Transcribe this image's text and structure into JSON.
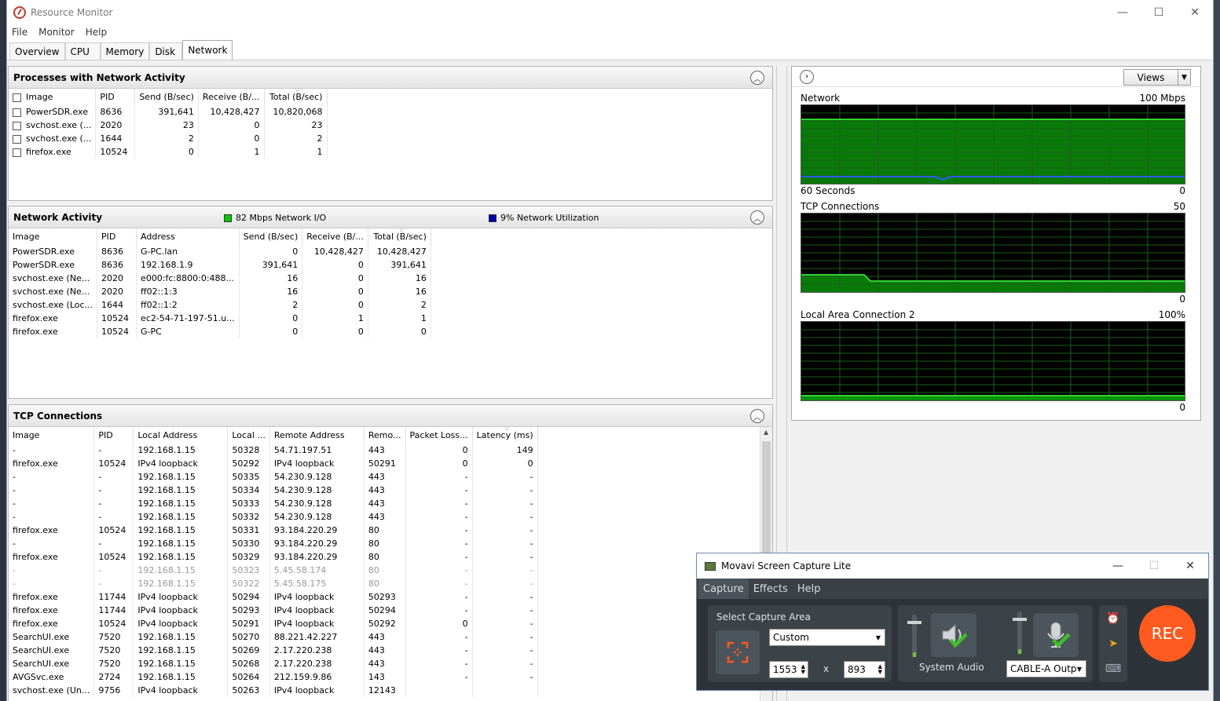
{
  "window": {
    "title": "Resource Monitor",
    "controls": {
      "minimize": "—",
      "maximize": "☐",
      "close": "✕"
    }
  },
  "menu": [
    "File",
    "Monitor",
    "Help"
  ],
  "tabs": [
    "Overview",
    "CPU",
    "Memory",
    "Disk",
    "Network"
  ],
  "active_tab": "Network",
  "processes": {
    "title": "Processes with Network Activity",
    "columns": [
      "Image",
      "PID",
      "Send (B/sec)",
      "Receive (B/...",
      "Total (B/sec)"
    ],
    "rows": [
      [
        "PowerSDR.exe",
        "8636",
        "391,641",
        "10,428,427",
        "10,820,068"
      ],
      [
        "svchost.exe (...",
        "2020",
        "23",
        "0",
        "23"
      ],
      [
        "svchost.exe (...",
        "1644",
        "2",
        "0",
        "2"
      ],
      [
        "firefox.exe",
        "10524",
        "0",
        "1",
        "1"
      ]
    ]
  },
  "network_activity": {
    "title": "Network Activity",
    "legend_io": "82 Mbps Network I/O",
    "legend_util": "9% Network Utilization",
    "legend_io_color": "#00cc00",
    "legend_util_color": "#0000aa",
    "columns": [
      "Image",
      "PID",
      "Address",
      "Send (B/sec)",
      "Receive (B/...",
      "Total (B/sec)"
    ],
    "rows": [
      [
        "PowerSDR.exe",
        "8636",
        "G-PC.lan",
        "0",
        "10,428,427",
        "10,428,427"
      ],
      [
        "PowerSDR.exe",
        "8636",
        "192.168.1.9",
        "391,641",
        "0",
        "391,641"
      ],
      [
        "svchost.exe (Ne...",
        "2020",
        "e000:fc:8800:0:488...",
        "16",
        "0",
        "16"
      ],
      [
        "svchost.exe (Ne...",
        "2020",
        "ff02::1:3",
        "16",
        "0",
        "16"
      ],
      [
        "svchost.exe (Loc...",
        "1644",
        "ff02::1:2",
        "2",
        "0",
        "2"
      ],
      [
        "firefox.exe",
        "10524",
        "ec2-54-71-197-51.u...",
        "0",
        "1",
        "1"
      ],
      [
        "firefox.exe",
        "10524",
        "G-PC",
        "0",
        "0",
        "0"
      ]
    ]
  },
  "tcp": {
    "title": "TCP Connections",
    "columns": [
      "Image",
      "PID",
      "Local Address",
      "Local ...",
      "Remote Address",
      "Remo...",
      "Packet Loss...",
      "Latency (ms)"
    ],
    "rows": [
      [
        "-",
        "-",
        "192.168.1.15",
        "50328",
        "54.71.197.51",
        "443",
        "0",
        "149"
      ],
      [
        "firefox.exe",
        "10524",
        "IPv4 loopback",
        "50292",
        "IPv4 loopback",
        "50291",
        "0",
        "0"
      ],
      [
        "-",
        "-",
        "192.168.1.15",
        "50335",
        "54.230.9.128",
        "443",
        "-",
        "-"
      ],
      [
        "-",
        "-",
        "192.168.1.15",
        "50334",
        "54.230.9.128",
        "443",
        "-",
        "-"
      ],
      [
        "-",
        "-",
        "192.168.1.15",
        "50333",
        "54.230.9.128",
        "443",
        "-",
        "-"
      ],
      [
        "-",
        "-",
        "192.168.1.15",
        "50332",
        "54.230.9.128",
        "443",
        "-",
        "-"
      ],
      [
        "firefox.exe",
        "10524",
        "192.168.1.15",
        "50331",
        "93.184.220.29",
        "80",
        "-",
        "-"
      ],
      [
        "-",
        "-",
        "192.168.1.15",
        "50330",
        "93.184.220.29",
        "80",
        "-",
        "-"
      ],
      [
        "firefox.exe",
        "10524",
        "192.168.1.15",
        "50329",
        "93.184.220.29",
        "80",
        "-",
        "-"
      ],
      [
        "-",
        "-",
        "192.168.1.15",
        "50323",
        "5.45.58.174",
        "80",
        "-",
        "-"
      ],
      [
        "-",
        "-",
        "192.168.1.15",
        "50322",
        "5.45.58.175",
        "80",
        "-",
        "-"
      ],
      [
        "firefox.exe",
        "11744",
        "IPv4 loopback",
        "50294",
        "IPv4 loopback",
        "50293",
        "-",
        "-"
      ],
      [
        "firefox.exe",
        "11744",
        "IPv4 loopback",
        "50293",
        "IPv4 loopback",
        "50294",
        "-",
        "-"
      ],
      [
        "firefox.exe",
        "10524",
        "IPv4 loopback",
        "50291",
        "IPv4 loopback",
        "50292",
        "0",
        "-"
      ],
      [
        "SearchUI.exe",
        "7520",
        "192.168.1.15",
        "50270",
        "88.221.42.227",
        "443",
        "-",
        "-"
      ],
      [
        "SearchUI.exe",
        "7520",
        "192.168.1.15",
        "50269",
        "2.17.220.238",
        "443",
        "-",
        "-"
      ],
      [
        "SearchUI.exe",
        "7520",
        "192.168.1.15",
        "50268",
        "2.17.220.238",
        "443",
        "-",
        "-"
      ],
      [
        "AVGSvc.exe",
        "2724",
        "192.168.1.15",
        "50264",
        "212.159.9.86",
        "143",
        "-",
        "-"
      ],
      [
        "svchost.exe (Un...",
        "9756",
        "IPv4 loopback",
        "50263",
        "IPv4 loopback",
        "12143",
        "",
        ""
      ]
    ],
    "dim_rows": [
      9,
      10
    ]
  },
  "graphs": {
    "views_label": "Views",
    "network": {
      "label": "Network",
      "max": "100 Mbps",
      "foot_left": "60 Seconds",
      "foot_right": "0",
      "io_level": 0.82,
      "util_level": 0.09
    },
    "tcp": {
      "label": "TCP Connections",
      "max": "50",
      "foot_right": "0",
      "start_level": 0.22,
      "end_level": 0.14
    },
    "lan": {
      "label": "Local Area Connection 2",
      "max": "100%",
      "foot_right": "0",
      "level": 0.06
    }
  },
  "movavi": {
    "title": "Movavi Screen Capture Lite",
    "menu": [
      "Capture",
      "Effects",
      "Help"
    ],
    "select_area_label": "Select Capture Area",
    "area_value": "Custom",
    "width": "1553",
    "height": "893",
    "by": "x",
    "system_audio_label": "System Audio",
    "mic_value": "CABLE-A Outp",
    "rec_label": "REC",
    "controls": {
      "minimize": "—",
      "maximize": "☐",
      "close": "✕"
    }
  }
}
